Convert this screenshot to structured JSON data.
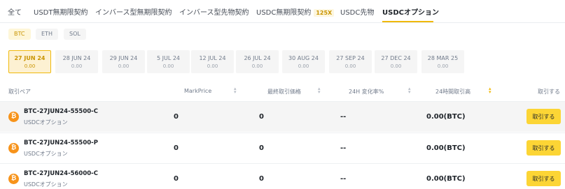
{
  "tabs": {
    "all": "全て",
    "usdt_perpetual": "USDT無期限契約",
    "inverse_perpetual": "インバース型無期限契約",
    "inverse_futures": "インバース型先物契約",
    "usdc_perpetual": "USDC無期限契約",
    "usdc_perpetual_badge": "125X",
    "usdc_futures": "USDC先物",
    "usdc_options": "USDCオプション"
  },
  "assets": [
    "BTC",
    "ETH",
    "SOL"
  ],
  "selected_asset": "BTC",
  "expiries": [
    {
      "date": "27 JUN 24",
      "value": "0.00",
      "active": true
    },
    {
      "date": "28 JUN 24",
      "value": "0.00"
    },
    {
      "date": "29 JUN 24",
      "value": "0.00"
    },
    {
      "date": "5 JUL 24",
      "value": "0.00"
    },
    {
      "date": "12 JUL 24",
      "value": "0.00"
    },
    {
      "date": "26 JUL 24",
      "value": "0.00"
    },
    {
      "date": "30 AUG 24",
      "value": "0.00"
    },
    {
      "date": "27 SEP 24",
      "value": "0.00"
    },
    {
      "date": "27 DEC 24",
      "value": "0.00"
    },
    {
      "date": "28 MAR 25",
      "value": "0.00"
    }
  ],
  "table": {
    "headers": {
      "pair": "取引ペア",
      "mark_price": "MarkPrice",
      "last_price": "最終取引価格",
      "change_24h": "24H 変化率%",
      "volume_24h": "24時間取引高",
      "action": "取引する"
    },
    "rows": [
      {
        "symbol": "BTC-27JUN24-55500-C",
        "category": "USDCオプション",
        "mark_price": "0",
        "last_price": "0",
        "change": "--",
        "volume": "0.00(BTC)",
        "button": "取引する"
      },
      {
        "symbol": "BTC-27JUN24-55500-P",
        "category": "USDCオプション",
        "mark_price": "0",
        "last_price": "0",
        "change": "--",
        "volume": "0.00(BTC)",
        "button": "取引する"
      },
      {
        "symbol": "BTC-27JUN24-56000-C",
        "category": "USDCオプション",
        "mark_price": "0",
        "last_price": "0",
        "change": "--",
        "volume": "0.00(BTC)",
        "button": "取引する"
      }
    ]
  },
  "colors": {
    "accent": "#f0b90b",
    "button": "#fcd535",
    "coin": "#f7931a"
  }
}
